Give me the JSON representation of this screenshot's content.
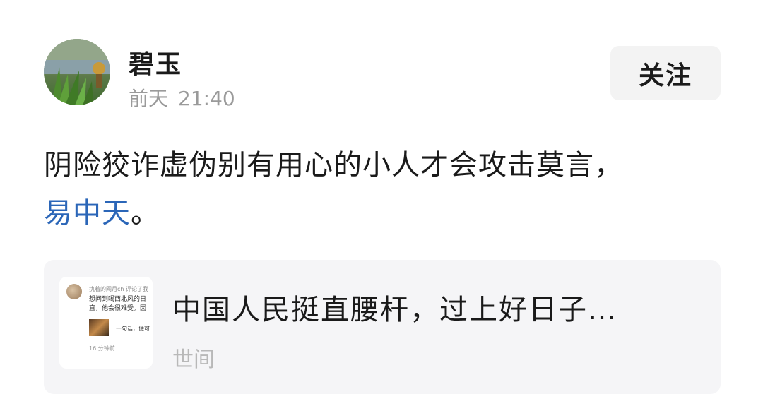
{
  "author": {
    "name": "碧玉",
    "date": "前天",
    "time": "21:40"
  },
  "follow_label": "关注",
  "post": {
    "text_main": "阴险狡诈虚伪别有用心的小人才会攻击莫言，",
    "mention": "易中天",
    "text_end": "。"
  },
  "quote": {
    "title": "中国人民挺直腰杆，过上好日子…",
    "source": "世间",
    "thumb": {
      "header": "执着的网月ch 评论了我",
      "body_line1": "想问到喝西北风的日",
      "body_line2": "直，他会很难受。因",
      "caption": "一句话，便可",
      "footer": "16 分钟前"
    }
  },
  "colors": {
    "mention": "#2b66b8",
    "follow_bg": "#f3f3f3",
    "card_bg": "#f5f5f7"
  }
}
